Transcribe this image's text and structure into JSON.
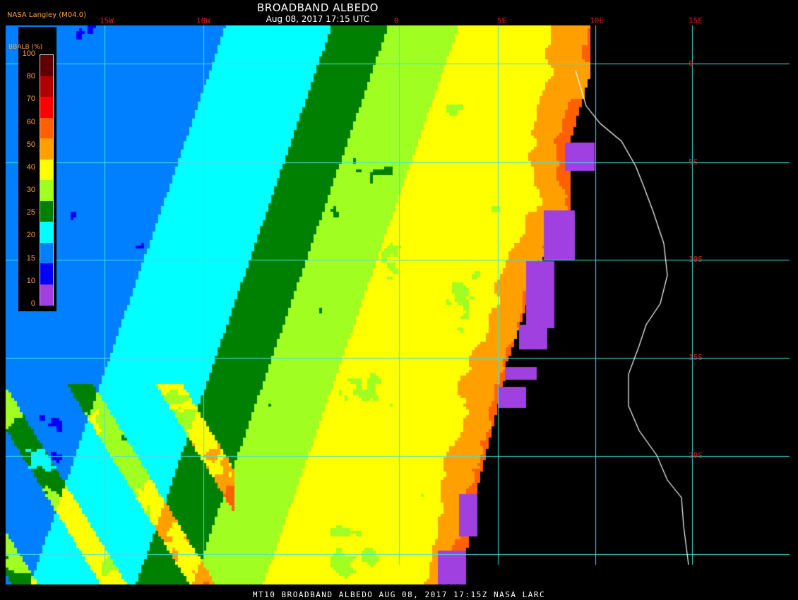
{
  "header": {
    "title": "BROADBAND ALBEDO",
    "subtitle": "Aug 08, 2017 17:15 UTC",
    "org": "NASA Langley (M04.0)"
  },
  "footer": {
    "text": "MT10  BROADBAND ALBEDO   AUG 08, 2017 17:15Z   NASA LARC"
  },
  "grid": {
    "longitude_labels": [
      "15W",
      "10W",
      "0",
      "5E",
      "10E",
      "15E"
    ],
    "latitude_labels": [
      "0",
      "5S",
      "10S",
      "15S",
      "20S"
    ],
    "line_color": "#40e0e0",
    "label_color": "#e02020"
  },
  "legend": {
    "title": "BBALB (%)",
    "ticks": [
      "100",
      "80",
      "70",
      "60",
      "50",
      "40",
      "30",
      "25",
      "20",
      "15",
      "10",
      "0"
    ],
    "colors": [
      "#600000",
      "#b00000",
      "#ff0000",
      "#ff6000",
      "#ffa000",
      "#ffff00",
      "#a0ff20",
      "#008000",
      "#00ffff",
      "#0080ff",
      "#0000ff",
      "#a040e0"
    ],
    "label_color": "#ffa040"
  },
  "coastline": {
    "color": "#ffffff"
  }
}
